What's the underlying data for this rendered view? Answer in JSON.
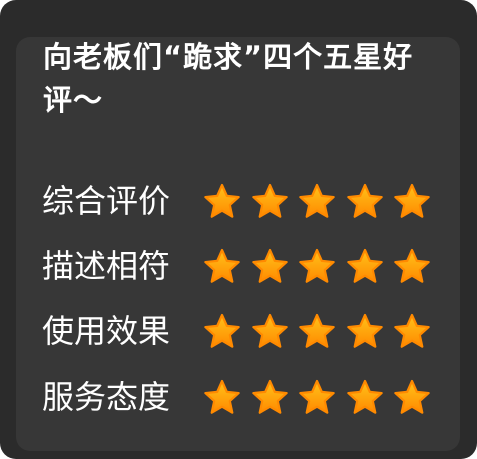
{
  "title": "向老板们“跪求”四个五星好评～",
  "colors": {
    "background": "#2b2b2b",
    "panel": "#373737",
    "text": "#ffffff",
    "star_light": "#ffc21a",
    "star_dark": "#ff8a00"
  },
  "ratings": [
    {
      "label": "综合评价",
      "stars": 5,
      "max": 5
    },
    {
      "label": "描述相符",
      "stars": 5,
      "max": 5
    },
    {
      "label": "使用效果",
      "stars": 5,
      "max": 5
    },
    {
      "label": "服务态度",
      "stars": 5,
      "max": 5
    }
  ],
  "icons": {
    "star": "star-icon"
  }
}
